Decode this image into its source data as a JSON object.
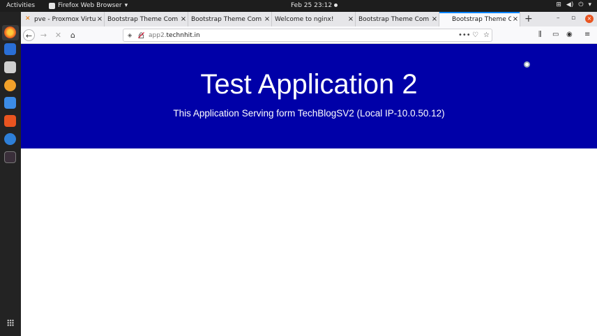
{
  "topbar": {
    "activities": "Activities",
    "app_name": "Firefox Web Browser",
    "clock": "Feb 25  23:12"
  },
  "tabs": [
    {
      "title": "pve - Proxmox Virtu"
    },
    {
      "title": "Bootstrap Theme Com"
    },
    {
      "title": "Bootstrap Theme Com"
    },
    {
      "title": "Welcome to nginx!"
    },
    {
      "title": "Bootstrap Theme Com"
    },
    {
      "title": "Bootstrap Theme C"
    }
  ],
  "url": {
    "prefix": "app2.",
    "domain": "technhit.in"
  },
  "page": {
    "heading": "Test Application 2",
    "subheading": "This Application Serving form TechBlogSV2 (Local IP-10.0.50.12)"
  },
  "colors": {
    "hero_bg": "#0000a8",
    "tab_accent": "#0a84ff",
    "ubuntu_orange": "#e95420"
  }
}
